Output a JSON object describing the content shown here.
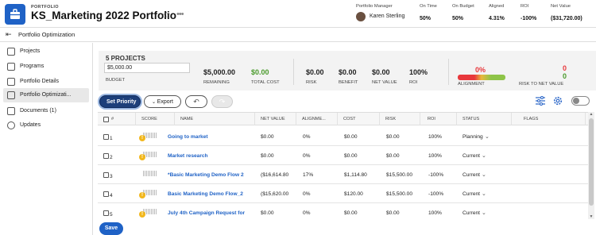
{
  "header": {
    "object_type": "PORTFOLIO",
    "title": "KS_Marketing 2022 Portfolio",
    "stats": [
      {
        "label": "Portfolio Manager",
        "value": "Karen Sterling"
      },
      {
        "label": "On Time",
        "value": "50%"
      },
      {
        "label": "On Budget",
        "value": "50%"
      },
      {
        "label": "Aligned",
        "value": "4.31%"
      },
      {
        "label": "ROI",
        "value": "-100%"
      },
      {
        "label": "Net Value",
        "value": "($31,720.00)"
      }
    ]
  },
  "subheader": {
    "title": "Portfolio Optimization"
  },
  "sidebar": {
    "items": [
      {
        "label": "Projects",
        "icon": "projects-icon"
      },
      {
        "label": "Programs",
        "icon": "programs-icon"
      },
      {
        "label": "Portfolio Details",
        "icon": "details-icon"
      },
      {
        "label": "Portfolio Optimizati...",
        "icon": "optimization-icon",
        "active": true
      },
      {
        "label": "Documents (1)",
        "icon": "documents-icon"
      },
      {
        "label": "Updates",
        "icon": "updates-icon"
      }
    ]
  },
  "summary": {
    "count": "5 PROJECTS",
    "budget_value": "$5,000.00",
    "budget_label": "BUDGET",
    "remaining": {
      "value": "$5,000.00",
      "label": "REMAINING"
    },
    "total_cost": {
      "value": "$0.00",
      "label": "TOTAL COST"
    },
    "risk": {
      "value": "$0.00",
      "label": "RISK"
    },
    "benefit": {
      "value": "$0.00",
      "label": "BENEFIT"
    },
    "net_value": {
      "value": "$0.00",
      "label": "NET VALUE"
    },
    "roi": {
      "value": "100%",
      "label": "ROI"
    },
    "alignment": {
      "value": "0%",
      "label": "ALIGNMENT"
    },
    "risk_to_net": {
      "value_top": "0",
      "value_bottom": "0",
      "label": "RISK TO NET VALUE"
    }
  },
  "toolbar": {
    "set_priority": "Set Priority",
    "export": "Export",
    "undo": "↶",
    "redo": "↷"
  },
  "table": {
    "columns": [
      "SCORE",
      "NAME",
      "NET VALUE",
      "ALIGNME...",
      "COST",
      "RISK",
      "ROI",
      "STATUS",
      "FLAGS"
    ],
    "sort_marker": "#",
    "rows": [
      {
        "num": "1",
        "name": "Going to market",
        "net_value": "$0.00",
        "alignment": "0%",
        "cost": "$0.00",
        "risk": "$0.00",
        "roi": "100%",
        "status": "Planning",
        "warn": true
      },
      {
        "num": "2",
        "name": "Market research",
        "net_value": "$0.00",
        "alignment": "0%",
        "cost": "$0.00",
        "risk": "$0.00",
        "roi": "100%",
        "status": "Current",
        "warn": true
      },
      {
        "num": "3",
        "name": "*Basic Marketing Demo Flow 2",
        "net_value": "($16,614.80",
        "alignment": "17%",
        "cost": "$1,114.80",
        "risk": "$15,500.00",
        "roi": "-100%",
        "status": "Current",
        "warn": false
      },
      {
        "num": "4",
        "name": "Basic Marketing Demo Flow_2",
        "net_value": "($15,620.00",
        "alignment": "0%",
        "cost": "$120.00",
        "risk": "$15,500.00",
        "roi": "-100%",
        "status": "Current",
        "warn": true
      },
      {
        "num": "5",
        "name": "July 4th Campaign Request for",
        "net_value": "$0.00",
        "alignment": "0%",
        "cost": "$0.00",
        "risk": "$0.00",
        "roi": "100%",
        "status": "Current",
        "warn": true
      }
    ]
  },
  "footer": {
    "save": "Save"
  },
  "colors": {
    "accent": "#1f62c6",
    "primary_button": "#1d3f7a",
    "warning": "#f2b71c",
    "alignment_red": "#e8383c",
    "alignment_green": "#8ec448",
    "positive": "#4a9a2c"
  }
}
